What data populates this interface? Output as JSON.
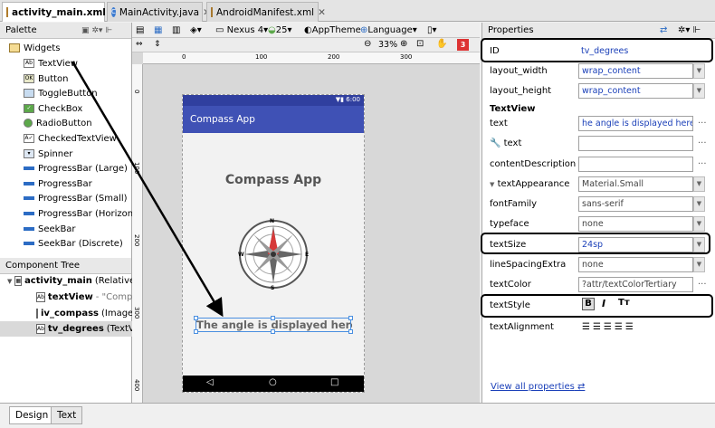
{
  "tabs": [
    {
      "label": "activity_main.xml",
      "active": true
    },
    {
      "label": "MainActivity.java",
      "active": false
    },
    {
      "label": "AndroidManifest.xml",
      "active": false
    }
  ],
  "palette": {
    "title": "Palette",
    "group": "Widgets",
    "items": [
      "TextView",
      "Button",
      "ToggleButton",
      "CheckBox",
      "RadioButton",
      "CheckedTextView",
      "Spinner",
      "ProgressBar (Large)",
      "ProgressBar",
      "ProgressBar (Small)",
      "ProgressBar (Horizontal)",
      "SeekBar",
      "SeekBar (Discrete)"
    ]
  },
  "tree": {
    "title": "Component Tree",
    "root": "activity_main",
    "root_suffix": "(RelativeLa",
    "children": [
      {
        "name": "textView",
        "suffix": "- \"Compas"
      },
      {
        "name": "iv_compass",
        "suffix": "(ImageV"
      },
      {
        "name": "tv_degrees",
        "suffix": "(TextView"
      }
    ]
  },
  "toolbar": {
    "device": "Nexus 4",
    "api": "25",
    "theme": "AppTheme",
    "language": "Language",
    "zoom": "33%",
    "warnings": "3"
  },
  "ruler": {
    "h_ticks": [
      "0",
      "100",
      "200",
      "300"
    ],
    "v_ticks": [
      "0",
      "100",
      "200",
      "300",
      "400"
    ]
  },
  "phone": {
    "status_time": "6:00",
    "appbar_title": "Compass App",
    "heading": "Compass App",
    "degrees_text": "The angle is displayed here...",
    "compass_letters": [
      "N",
      "E",
      "S",
      "W"
    ]
  },
  "properties": {
    "title": "Properties",
    "id_label": "ID",
    "id_value": "tv_degrees",
    "layout_width_label": "layout_width",
    "layout_width": "wrap_content",
    "layout_height_label": "layout_height",
    "layout_height": "wrap_content",
    "section": "TextView",
    "text_label": "text",
    "text_value": "he angle is displayed here...",
    "text_tools_label": "text",
    "content_desc_label": "contentDescription",
    "text_appearance_label": "textAppearance",
    "text_appearance": "Material.Small",
    "font_family_label": "fontFamily",
    "font_family": "sans-serif",
    "typeface_label": "typeface",
    "typeface": "none",
    "text_size_label": "textSize",
    "text_size": "24sp",
    "line_spacing_label": "lineSpacingExtra",
    "line_spacing": "none",
    "text_color_label": "textColor",
    "text_color": "?attr/textColorTertiary",
    "text_style_label": "textStyle",
    "text_alignment_label": "textAlignment",
    "view_all": "View all properties"
  },
  "bottom_tabs": [
    {
      "label": "Design",
      "active": true
    },
    {
      "label": "Text",
      "active": false
    }
  ],
  "colors": {
    "appbar": "#3f51b5",
    "statusbar": "#303f9f",
    "selection": "#4a8fe0",
    "link": "#1a3fb8"
  }
}
